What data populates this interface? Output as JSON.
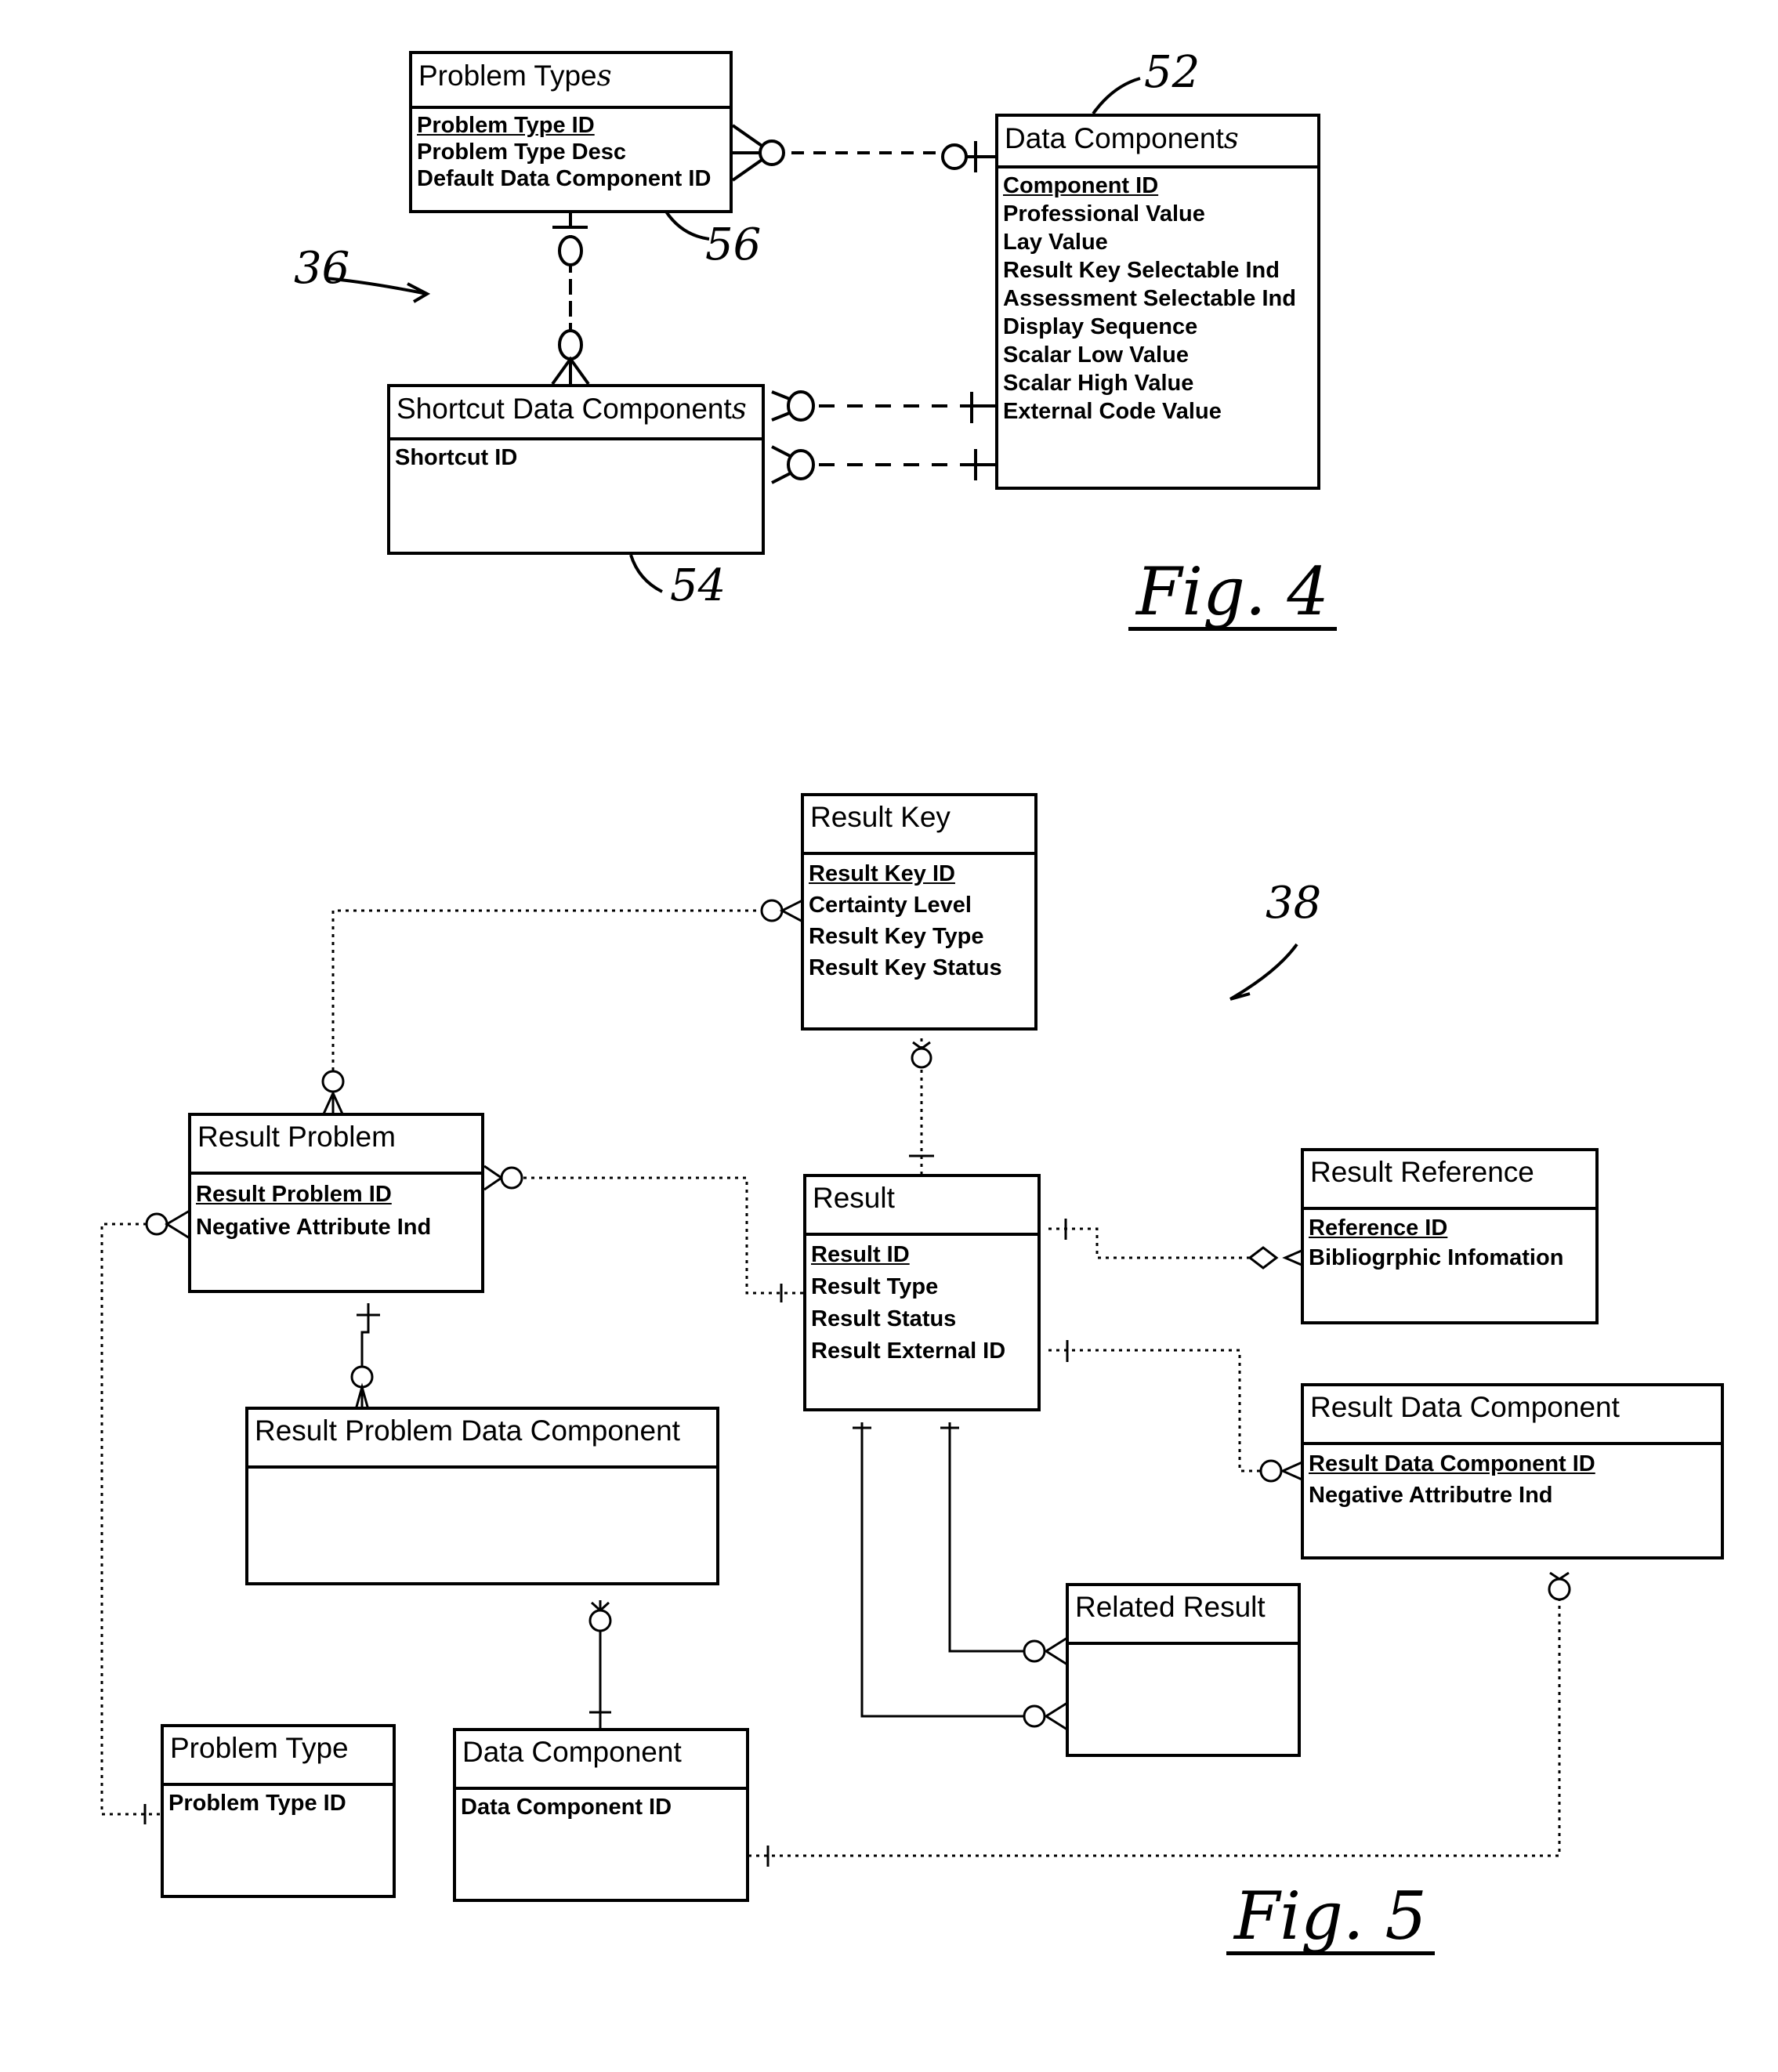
{
  "figure4": {
    "reference_number": "36",
    "label": "Fig. 4",
    "entities": {
      "problem_types": {
        "ref": "56",
        "title": "Problem Type",
        "title_suffix": "s",
        "attributes": [
          "Problem Type ID",
          "Problem Type Desc",
          "Default Data Component ID"
        ],
        "primary_key": "Problem Type ID"
      },
      "data_components": {
        "ref": "52",
        "title": "Data Component",
        "title_suffix": "s",
        "attributes": [
          "Component ID",
          "Professional Value",
          "Lay Value",
          "Result Key Selectable Ind",
          "Assessment Selectable Ind",
          "Display Sequence",
          "Scalar Low Value",
          "Scalar High Value",
          "External Code Value"
        ],
        "primary_key": "Component ID"
      },
      "shortcut_data_components": {
        "ref": "54",
        "title": "Shortcut Data Component",
        "title_suffix": "s",
        "attributes": [
          "Shortcut ID"
        ]
      }
    }
  },
  "figure5": {
    "reference_number": "38",
    "label": "Fig. 5",
    "entities": {
      "result_key": {
        "title": "Result Key",
        "attributes": [
          "Result Key ID",
          "Certainty Level",
          "Result Key Type",
          "Result Key Status"
        ],
        "primary_key": "Result Key ID"
      },
      "result_problem": {
        "title": "Result Problem",
        "attributes": [
          "Result Problem ID",
          "Negative Attribute Ind"
        ],
        "primary_key": "Result Problem ID"
      },
      "result": {
        "title": "Result",
        "attributes": [
          "Result ID",
          "Result Type",
          "Result Status",
          "Result External ID"
        ],
        "primary_key": "Result ID"
      },
      "result_reference": {
        "title": "Result Reference",
        "attributes": [
          "Reference ID",
          "Bibliogrphic Infomation"
        ],
        "primary_key": "Reference ID"
      },
      "result_data_component": {
        "title": "Result Data Component",
        "attributes": [
          "Result Data Component ID",
          "Negative Attributre Ind"
        ],
        "primary_key": "Result Data Component ID"
      },
      "result_problem_data_component": {
        "title": "Result Problem Data Component",
        "attributes": []
      },
      "related_result": {
        "title": "Related Result",
        "attributes": []
      },
      "problem_type": {
        "title": "Problem Type",
        "attributes": [
          "Problem Type ID"
        ]
      },
      "data_component": {
        "title": "Data Component",
        "attributes": [
          "Data Component ID"
        ]
      }
    }
  }
}
